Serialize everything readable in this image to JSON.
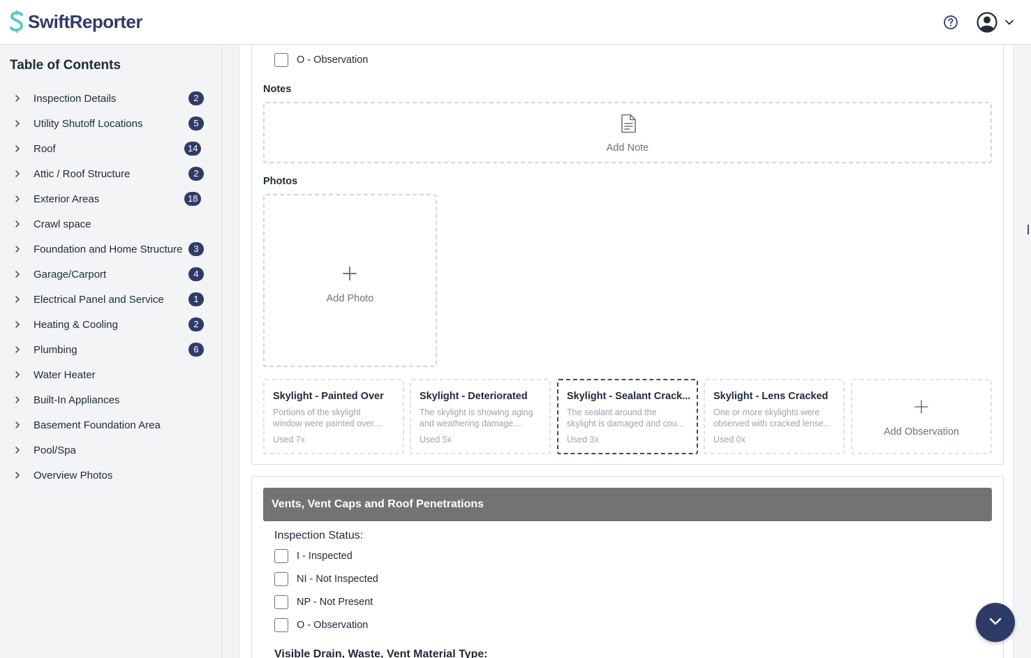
{
  "app": {
    "name": "SwiftReporter",
    "brand_color": "#2f3b67",
    "logo_accent": "#5fc6c4"
  },
  "header": {
    "help_icon": "question-circle-icon",
    "user_icon": "user-circle-icon",
    "menu_icon": "chevron-down-icon"
  },
  "sidebar": {
    "title": "Table of Contents",
    "items": [
      {
        "label": "Inspection Details",
        "badge": "2"
      },
      {
        "label": "Utility Shutoff Locations",
        "badge": "5"
      },
      {
        "label": "Roof",
        "badge": "14"
      },
      {
        "label": "Attic / Roof Structure",
        "badge": "2"
      },
      {
        "label": "Exterior Areas",
        "badge": "18"
      },
      {
        "label": "Crawl space",
        "badge": ""
      },
      {
        "label": "Foundation and Home Structure",
        "badge": "3"
      },
      {
        "label": "Garage/Carport",
        "badge": "4"
      },
      {
        "label": "Electrical Panel and Service",
        "badge": "1"
      },
      {
        "label": "Heating & Cooling",
        "badge": "2"
      },
      {
        "label": "Plumbing",
        "badge": "6"
      },
      {
        "label": "Water Heater",
        "badge": ""
      },
      {
        "label": "Built-In Appliances",
        "badge": ""
      },
      {
        "label": "Basement Foundation Area",
        "badge": ""
      },
      {
        "label": "Pool/Spa",
        "badge": ""
      },
      {
        "label": "Overview Photos",
        "badge": ""
      }
    ]
  },
  "skylight_section": {
    "status_option": "O - Observation",
    "notes_label": "Notes",
    "add_note": "Add Note",
    "photos_label": "Photos",
    "add_photo": "Add Photo",
    "observations": [
      {
        "title": "Skylight - Painted Over",
        "desc1": "Portions of the skylight",
        "desc2": "window were painted over....",
        "used": "Used 7x"
      },
      {
        "title": "Skylight - Deteriorated",
        "desc1": "The skylight is showing aging",
        "desc2": "and weathering damage....",
        "used": "Used 5x"
      },
      {
        "title": "Skylight - Sealant Crack...",
        "desc1": "The sealant around the",
        "desc2": "skylight is damaged and cou...",
        "used": "Used 3x"
      },
      {
        "title": "Skylight - Lens Cracked",
        "desc1": "One or more skylights were",
        "desc2": "observed with cracked lense...",
        "used": "Used 0x"
      }
    ],
    "add_observation": "Add Observation"
  },
  "vents_section": {
    "title": "Vents, Vent Caps and Roof Penetrations",
    "status_label": "Inspection Status:",
    "options": [
      "I - Inspected",
      "NI - Not Inspected",
      "NP - Not Present",
      "O - Observation"
    ],
    "material_label": "Visible Drain, Waste, Vent Material Type:"
  }
}
